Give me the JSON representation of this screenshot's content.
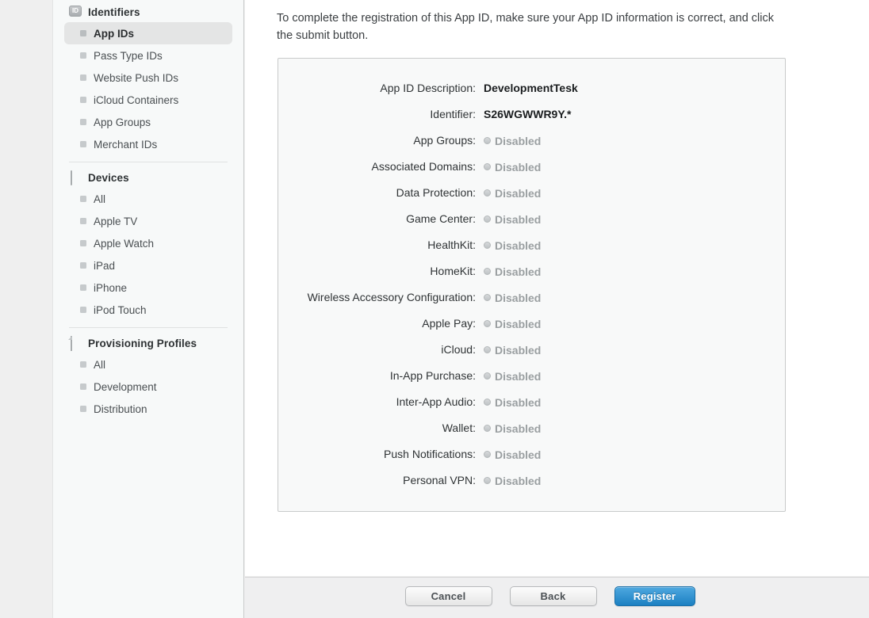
{
  "sidebar": {
    "groups": [
      {
        "label": "Identifiers",
        "icon": "id-badge-icon",
        "icon_text": "ID",
        "items": [
          {
            "label": "App IDs",
            "active": true
          },
          {
            "label": "Pass Type IDs",
            "active": false
          },
          {
            "label": "Website Push IDs",
            "active": false
          },
          {
            "label": "iCloud Containers",
            "active": false
          },
          {
            "label": "App Groups",
            "active": false
          },
          {
            "label": "Merchant IDs",
            "active": false
          }
        ]
      },
      {
        "label": "Devices",
        "icon": "device-icon",
        "items": [
          {
            "label": "All",
            "active": false
          },
          {
            "label": "Apple TV",
            "active": false
          },
          {
            "label": "Apple Watch",
            "active": false
          },
          {
            "label": "iPad",
            "active": false
          },
          {
            "label": "iPhone",
            "active": false
          },
          {
            "label": "iPod Touch",
            "active": false
          }
        ]
      },
      {
        "label": "Provisioning Profiles",
        "icon": "document-icon",
        "items": [
          {
            "label": "All",
            "active": false
          },
          {
            "label": "Development",
            "active": false
          },
          {
            "label": "Distribution",
            "active": false
          }
        ]
      }
    ]
  },
  "main": {
    "intro": "To complete the registration of this App ID, make sure your App ID information is correct, and click the submit button.",
    "summary_rows": [
      {
        "label": "App ID Description:",
        "value": "DevelopmentTesk",
        "muted": false,
        "radio": false
      },
      {
        "label": "Identifier:",
        "value": "S26WGWWR9Y.*",
        "muted": false,
        "radio": false
      },
      {
        "label": "App Groups:",
        "value": "Disabled",
        "muted": true,
        "radio": true
      },
      {
        "label": "Associated Domains:",
        "value": "Disabled",
        "muted": true,
        "radio": true
      },
      {
        "label": "Data Protection:",
        "value": "Disabled",
        "muted": true,
        "radio": true
      },
      {
        "label": "Game Center:",
        "value": "Disabled",
        "muted": true,
        "radio": true
      },
      {
        "label": "HealthKit:",
        "value": "Disabled",
        "muted": true,
        "radio": true
      },
      {
        "label": "HomeKit:",
        "value": "Disabled",
        "muted": true,
        "radio": true
      },
      {
        "label": "Wireless Accessory Configuration:",
        "value": "Disabled",
        "muted": true,
        "radio": true
      },
      {
        "label": "Apple Pay:",
        "value": "Disabled",
        "muted": true,
        "radio": true
      },
      {
        "label": "iCloud:",
        "value": "Disabled",
        "muted": true,
        "radio": true
      },
      {
        "label": "In-App Purchase:",
        "value": "Disabled",
        "muted": true,
        "radio": true
      },
      {
        "label": "Inter-App Audio:",
        "value": "Disabled",
        "muted": true,
        "radio": true
      },
      {
        "label": "Wallet:",
        "value": "Disabled",
        "muted": true,
        "radio": true
      },
      {
        "label": "Push Notifications:",
        "value": "Disabled",
        "muted": true,
        "radio": true
      },
      {
        "label": "Personal VPN:",
        "value": "Disabled",
        "muted": true,
        "radio": true
      }
    ]
  },
  "footer": {
    "cancel_label": "Cancel",
    "back_label": "Back",
    "register_label": "Register"
  },
  "colors": {
    "primary_button": "#1c80c2",
    "sidebar_bg": "#f7f9f9",
    "box_bg": "#f8f9f9",
    "footer_bg": "#efeff0"
  }
}
